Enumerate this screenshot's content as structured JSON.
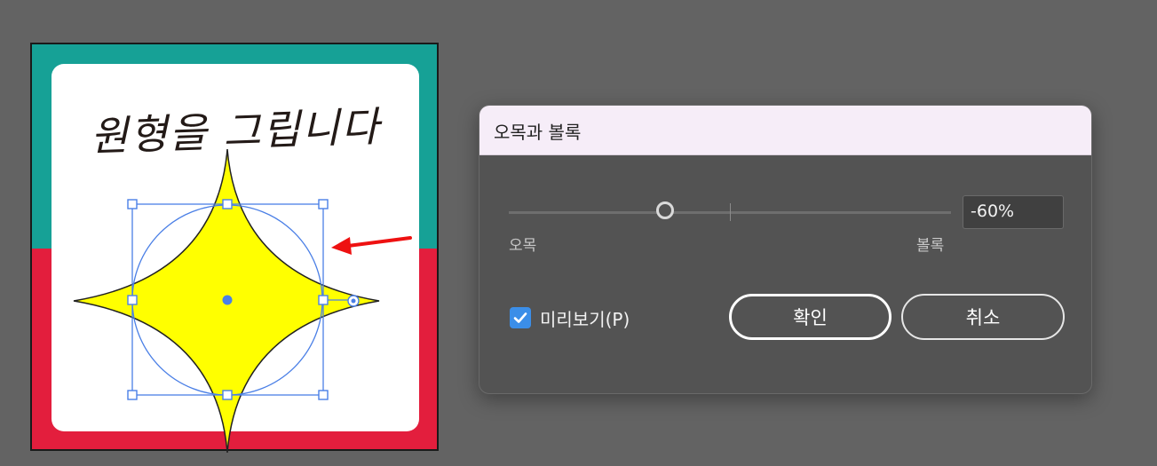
{
  "artboard": {
    "title": "원형을 그립니다",
    "colors": {
      "top": "#16a196",
      "bottom": "#e31e3d",
      "card": "#ffffff",
      "star": "#ffff00",
      "selection": "#4a7fe6"
    }
  },
  "dialog": {
    "title": "오목과 볼록",
    "slider": {
      "left_label": "오목",
      "right_label": "볼록",
      "value": "-60%",
      "value_numeric": -60,
      "range": [
        -200,
        200
      ]
    },
    "preview": {
      "label": "미리보기(P)",
      "checked": true
    },
    "ok_label": "확인",
    "cancel_label": "취소"
  },
  "annotations": {
    "arrow_color": "#ee1111"
  }
}
